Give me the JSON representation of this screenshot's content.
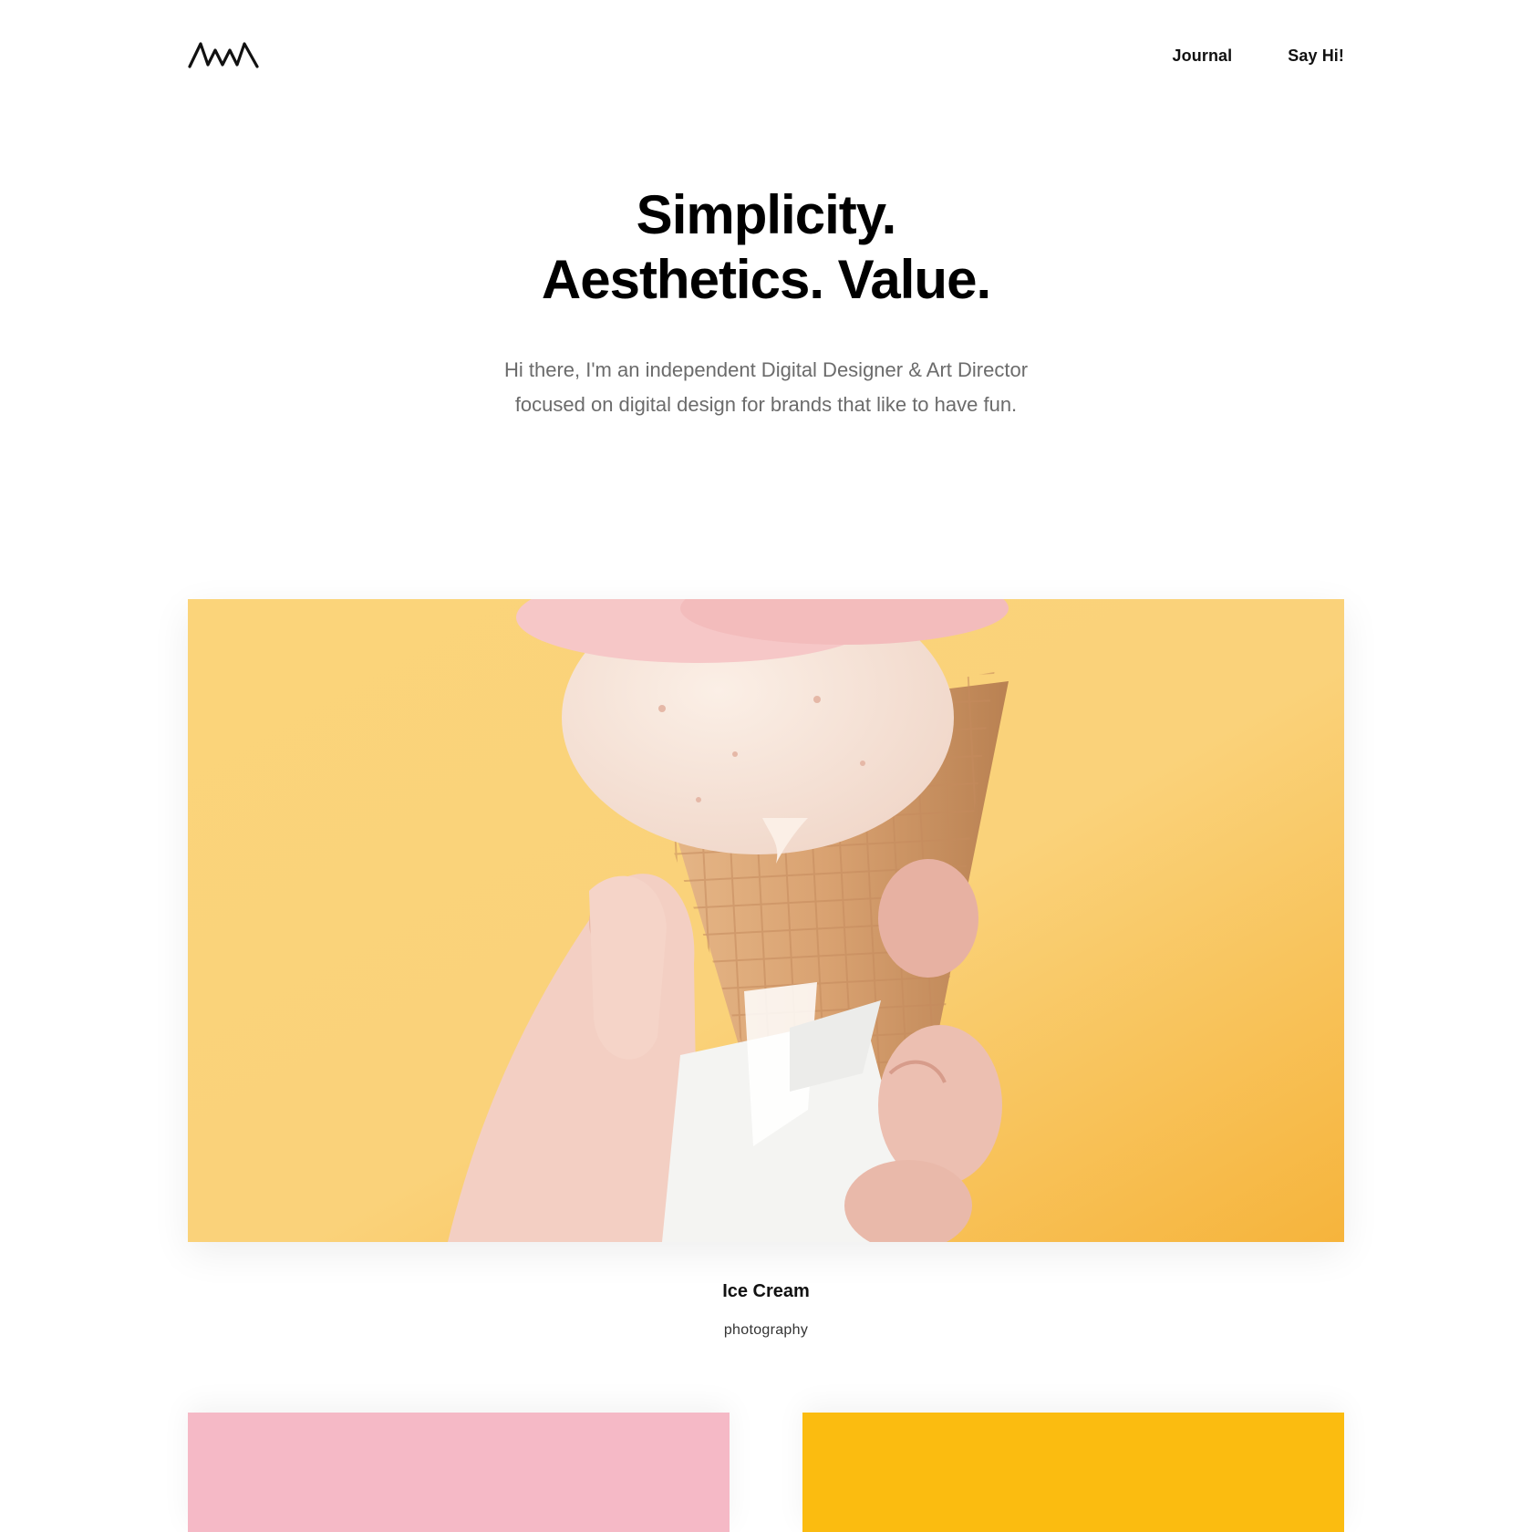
{
  "header": {
    "logo_name": "wave-logo",
    "nav": [
      {
        "label": "Journal"
      },
      {
        "label": "Say Hi!"
      }
    ]
  },
  "hero": {
    "title_line1": "Simplicity.",
    "title_line2": "Aesthetics. Value.",
    "intro": "Hi there, I'm an independent Digital Designer & Art Director focused on digital design for brands that like to have fun."
  },
  "featured_project": {
    "image": "ice-cream-cone-photo",
    "title": "Ice Cream",
    "category": "photography"
  },
  "project_tiles": [
    {
      "color": "#f5b9c6"
    },
    {
      "color": "#fbbc10"
    }
  ],
  "colors": {
    "photo_background": "#f9c563",
    "text_primary": "#111111",
    "text_muted": "#6b6b6b"
  }
}
